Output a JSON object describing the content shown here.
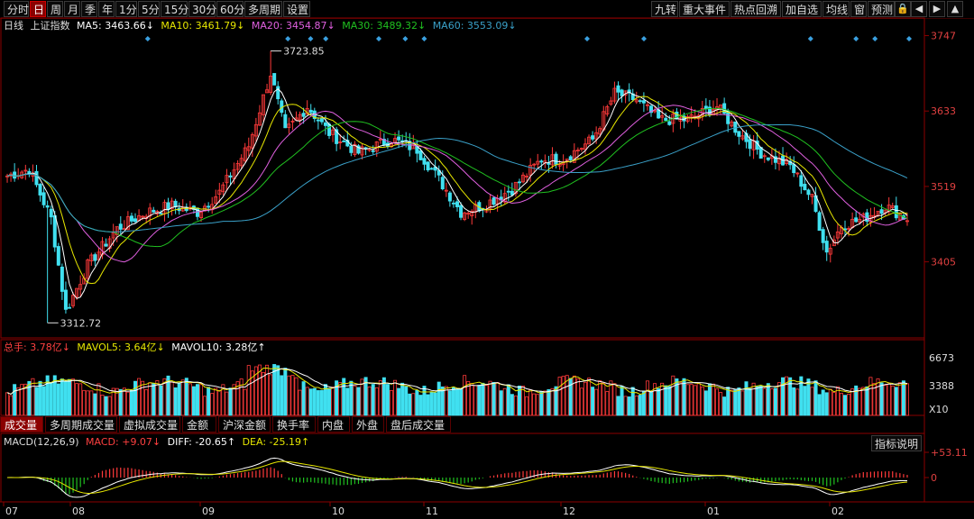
{
  "toolbar": {
    "left": [
      "分时",
      "日",
      "周",
      "月",
      "季",
      "年",
      "1分",
      "5分",
      "15分",
      "30分",
      "60分",
      "多周期",
      "设置"
    ],
    "active": "日",
    "right": [
      "九转",
      "重大事件",
      "热点回溯",
      "加自选",
      "均线",
      "窗",
      "预测"
    ]
  },
  "legend_main": {
    "period": "日线",
    "name": "上证指数",
    "ma5": "MA5: 3463.66↓",
    "ma10": "MA10: 3461.79↓",
    "ma20": "MA20: 3454.87↓",
    "ma30": "MA30: 3489.32↓",
    "ma60": "MA60: 3553.09↓"
  },
  "legend_vol": {
    "total": "总手: 3.78亿↓",
    "mavol5": "MAVOL5: 3.64亿↓",
    "mavol10": "MAVOL10: 3.28亿↑"
  },
  "legend_macd": {
    "params": "MACD(12,26,9)",
    "macd": "MACD: +9.07↓",
    "diff": "DIFF: -20.65↑",
    "dea": "DEA: -25.19↑",
    "help": "指标说明"
  },
  "tabs": [
    "成交量",
    "多周期成交量",
    "虚拟成交量",
    "金额",
    "沪深金额",
    "换手率",
    "内盘",
    "外盘",
    "盘后成交量"
  ],
  "active_tab": "成交量",
  "colors": {
    "up": "#ff3a3a",
    "down": "#40e0f0",
    "ma5": "#ffffff",
    "ma10": "#e6e600",
    "ma20": "#e060e0",
    "ma30": "#20c020",
    "ma60": "#3aa0c8",
    "diamond": "#3aa0e0"
  },
  "chart_data": {
    "type": "candlestick",
    "y_axis_ticks": [
      "3747",
      "3633",
      "3519",
      "3405"
    ],
    "ylim": [
      3290,
      3760
    ],
    "annotations": {
      "high_label": "3723.85",
      "low_label": "3312.72"
    },
    "volume_axis": {
      "ticks": [
        "6673",
        "3388"
      ],
      "unit": "X10"
    },
    "macd_axis": {
      "ticks": [
        "+53.11",
        "0"
      ]
    },
    "x_labels": [
      "07",
      "08",
      "09",
      "10",
      "11",
      "12",
      "01",
      "02"
    ]
  }
}
